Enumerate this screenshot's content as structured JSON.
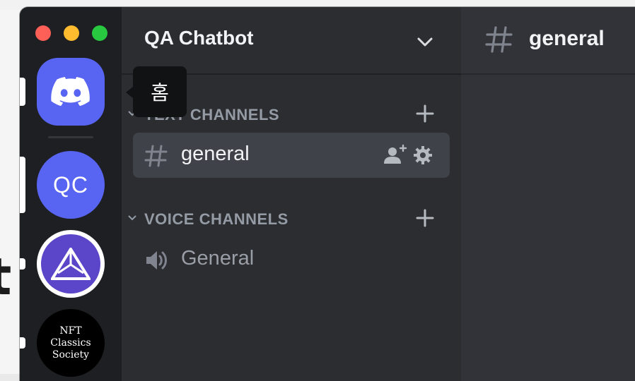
{
  "traffic_lights": {
    "close": "#fe5f57",
    "minimize": "#febc2e",
    "zoom": "#28c840"
  },
  "servers": [
    {
      "name": "home",
      "icon": "discord-logo-icon",
      "color": "#5865f2"
    },
    {
      "name": "qa-chatbot",
      "label": "QC",
      "color": "#5865f2"
    },
    {
      "name": "triangle-server",
      "icon": "triangle-logo-icon",
      "color": "#5b45c8"
    },
    {
      "name": "nft-classics-society",
      "label_lines": [
        "NFT",
        "Classics",
        "Society"
      ]
    }
  ],
  "tooltip": {
    "text": "홈"
  },
  "guild": {
    "name": "QA Chatbot"
  },
  "categories": [
    {
      "label": "TEXT CHANNELS",
      "channels": [
        {
          "name": "general",
          "icon": "hashtag-icon",
          "selected": true
        }
      ]
    },
    {
      "label": "VOICE CHANNELS",
      "channels": [
        {
          "name": "General",
          "icon": "speaker-icon",
          "selected": false
        }
      ]
    }
  ],
  "main": {
    "channel_title": "general",
    "icon": "hashtag-icon"
  },
  "colors": {
    "accent": "#5865f2",
    "rail": "#1e1f22",
    "sidebar": "#2b2d31",
    "main": "#313338",
    "selected": "#3f4248"
  }
}
